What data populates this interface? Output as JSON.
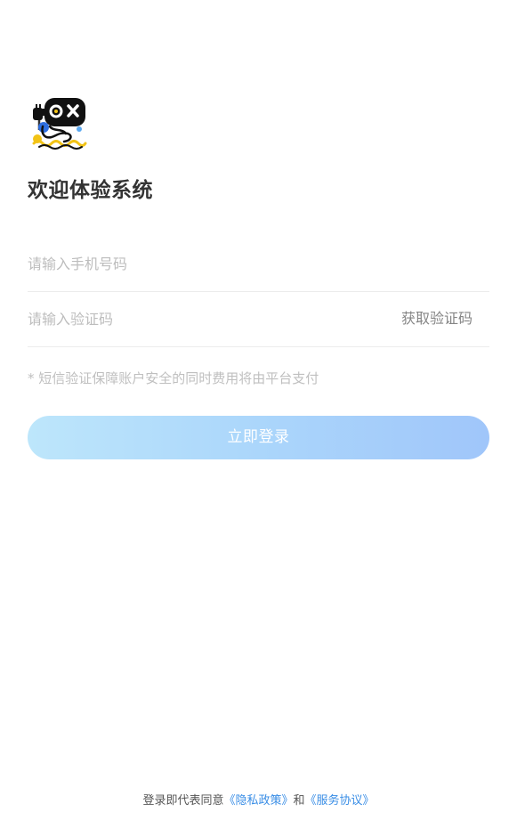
{
  "header": {
    "title": "欢迎体验系统"
  },
  "form": {
    "phone_placeholder": "请输入手机号码",
    "code_placeholder": "请输入验证码",
    "get_code_label": "获取验证码",
    "notice": "* 短信验证保障账户安全的同时费用将由平台支付",
    "login_label": "立即登录"
  },
  "footer": {
    "prefix": "登录即代表同意",
    "privacy_link": "《隐私政策》",
    "conjunction": "和",
    "service_link": "《服务协议》"
  },
  "colors": {
    "link": "#3a8ee6",
    "button_gradient_start": "#bde6fb",
    "button_gradient_end": "#a0c6fa",
    "placeholder": "#bdbdbd",
    "title": "#333333"
  },
  "icons": {
    "logo": "robot-mascot-logo"
  }
}
